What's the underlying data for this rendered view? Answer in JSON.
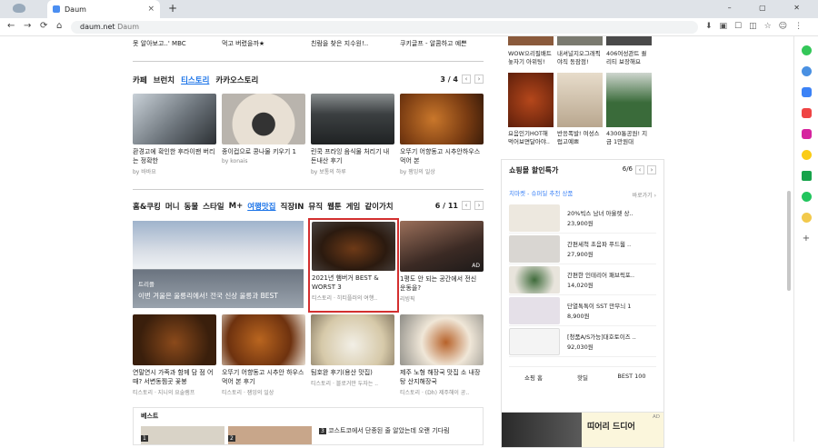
{
  "browser": {
    "tab_title": "Daum",
    "url_main": "daum.net",
    "url_sub": "Daum"
  },
  "top_strip": [
    "못 알아보고..' MBC",
    "먹고 버렸을까★",
    "친람을 찾은 지수원!..",
    "쿠키글프 - 알콤하고 예쁜"
  ],
  "sec1": {
    "tabs": [
      "카페",
      "브런치",
      "티스토리",
      "카카오스토리"
    ],
    "active": "티스토리",
    "page": "3 / 4",
    "cards": [
      {
        "cap": "환경고에 확인한 후라이팬 버리는 정확한",
        "src": "by 바바요"
      },
      {
        "cap": "종이컵으로 콩나물 키우기 1",
        "src": "by konais"
      },
      {
        "cap": "린쿡 프라잉 음식물 처리기 내돈내산 후기",
        "src": "by 보통의 하루"
      },
      {
        "cap": "오뚜기 어향동고 시추안하우스 먹어 본",
        "src": "by 잼잉의 일상"
      }
    ]
  },
  "sec2": {
    "tabs": [
      "홈&쿠킹",
      "머니",
      "동물",
      "스타일",
      "M+",
      "여행맛집",
      "직장IN",
      "뮤직",
      "웹툰",
      "게임",
      "같이가치"
    ],
    "active": "여행맛집",
    "page": "6 / 11",
    "big": {
      "tag": "트리플",
      "cap": "이번 겨울은 울릉리에서! 전국 신상 울릉과 BEST"
    },
    "hl": {
      "cap": "2021년 햄버거 BEST & WORST 3",
      "src": "티스토리 · 히티플러의 여행.."
    },
    "right": {
      "cap": "1평도 안 되는 공간에서 전신 운동을?",
      "src": "리빙픽",
      "ad": "AD"
    },
    "cards": [
      {
        "cap": "연말연시 가족과 함께 담 점 어때? 서변동찜곳 꽃봉",
        "src": "티스토리 · 지니의 요술램프"
      },
      {
        "cap": "오뚜기 어향동고 시추안 하우스 먹어 본 후기",
        "src": "티스토리 · 잼잉의 일상"
      },
      {
        "cap": "팀호완 후기(용산 맛집)",
        "src": "티스토리 · 블로거만 두자는 .."
      },
      {
        "cap": "제주 노형 해장국 맛집 소 내장탕 산지해장국",
        "src": "티스토리 · (Dh) 제주해이 공.."
      }
    ]
  },
  "best": {
    "label": "베스트",
    "item": "코스트코에서 단종된 줄 알았는데 오랜 기다림",
    "n1": "1",
    "n2": "2",
    "n3": "3"
  },
  "right_top": [
    {
      "cap": "WOW으리필배트 놓자기 아위팅!"
    },
    {
      "cap": "내셔널지오그래픽 야직 동잠점!"
    },
    {
      "cap": "406여성관트 퀄리티 보장해요"
    }
  ],
  "right_mid": [
    {
      "cap": "요음인기HOT해 먹어보면달아야.."
    },
    {
      "cap": "반응폭발! 여성스럽고예쁘"
    },
    {
      "cap": "4300통공원! 지금 1만원대"
    }
  ],
  "shop": {
    "title": "쇼핑몰 할인특가",
    "page": "6/6",
    "sub": "치마켓 - 슈퍼딜 추천 상품",
    "more": "바로가기 ›",
    "items": [
      {
        "name": "20%빅스 남녀 아울렛 상..",
        "price": "23,900원"
      },
      {
        "name": "간편세척 초음파 푸드웜 ..",
        "price": "27,900원"
      },
      {
        "name": "간편한 인테리어 패브릭포..",
        "price": "14,020원"
      },
      {
        "name": "단열톡톡이 SST 만무늬 1",
        "price": "8,900원"
      },
      {
        "name": "[청품A/S가능]대호토이즈 ..",
        "price": "92,030원"
      }
    ],
    "tabs": [
      "쇼핑 홈",
      "핫딜",
      "BEST 100"
    ]
  },
  "ad_block": {
    "label": "AD",
    "text": "띠어리 드디어"
  }
}
